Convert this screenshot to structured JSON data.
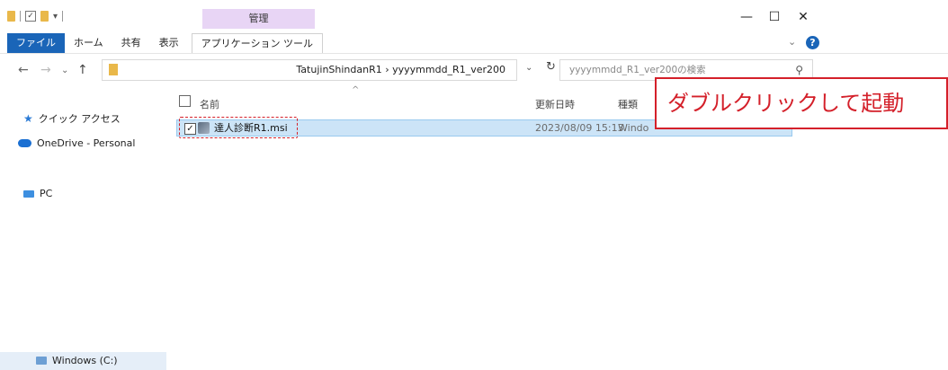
{
  "ribbon": {
    "context_group": "管理",
    "tabs": [
      "ファイル",
      "ホーム",
      "共有",
      "表示",
      "アプリケーション ツール"
    ]
  },
  "window_controls": {
    "minimize": "—",
    "maximize": "☐",
    "close": "✕"
  },
  "address": {
    "path": "TatujinShindanR1  ›  yyyymmdd_R1_ver200"
  },
  "search": {
    "placeholder": "yyyymmdd_R1_ver200の検索"
  },
  "nav": {
    "items": [
      "クイック アクセス",
      "OneDrive - Personal",
      "PC",
      "Windows (C:)"
    ]
  },
  "columns": {
    "name": "名前",
    "date": "更新日時",
    "type": "種類"
  },
  "files": [
    {
      "name": "達人診断R1.msi",
      "date": "2023/08/09 15:13",
      "type": "Windo"
    }
  ],
  "annotation": {
    "text": "ダブルクリックして起動"
  },
  "colors": {
    "accent": "#1a65b8",
    "annotation": "#d4202a",
    "selection": "#cce4f7",
    "context_tab": "#e8d5f5"
  },
  "icons": [
    "folder-icon",
    "checkbox-icon",
    "help-icon",
    "refresh-icon",
    "search-icon",
    "star-icon",
    "cloud-icon",
    "pc-icon",
    "drive-icon",
    "msi-file-icon"
  ]
}
